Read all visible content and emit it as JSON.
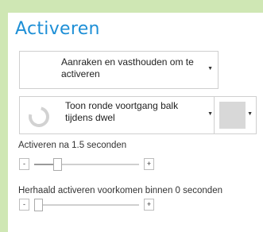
{
  "title": "Activeren",
  "activation_dropdown": {
    "value": "Aanraken en vasthouden om te activeren",
    "arrow_icon": "chevron-down-icon"
  },
  "progress_dropdown": {
    "value": "Toon ronde voortgang balk tijdens dwel",
    "icon": "spinner-icon",
    "arrow_icon": "chevron-down-icon"
  },
  "color_picker": {
    "swatch_color": "#d8d8d8",
    "arrow_icon": "chevron-down-icon"
  },
  "activate_after": {
    "label": "Activeren na 1.5 seconden",
    "minus_label": "-",
    "plus_label": "+",
    "level_fraction": 0.2
  },
  "repeat_prevent": {
    "label": "Herhaald activeren voorkomen binnen 0 seconden",
    "minus_label": "-",
    "plus_label": "+",
    "level_fraction": 0.0
  },
  "colors": {
    "background": "#cfe7b4",
    "title": "#1e8fd6"
  }
}
